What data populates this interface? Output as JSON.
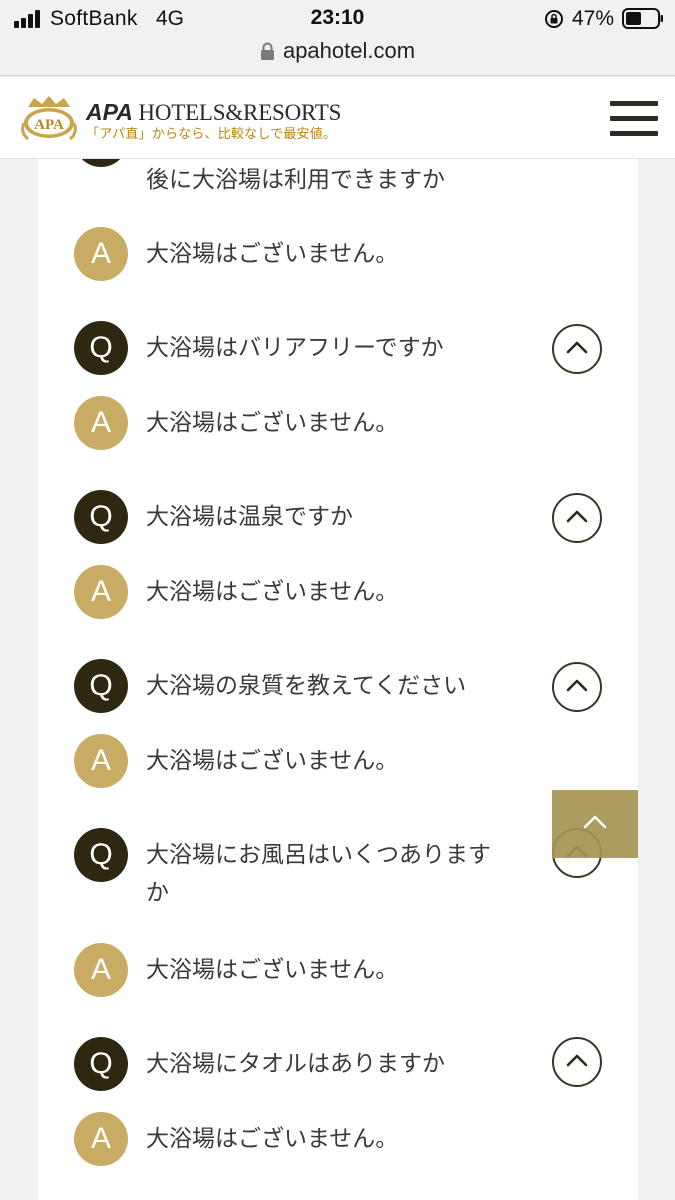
{
  "status_bar": {
    "carrier": "SoftBank",
    "network": "4G",
    "time": "23:10",
    "battery": "47%"
  },
  "browser": {
    "url": "apahotel.com"
  },
  "header": {
    "brand_prefix": "APA",
    "brand_suffix": " HOTELS&RESORTS",
    "tagline": "「アパ直」からなら、比較なしで最安値。",
    "emblem_text": "APA",
    "menu_icon": "hamburger-menu-icon"
  },
  "faq": {
    "partial_question": "後に大浴場は利用できますか",
    "items": [
      {
        "badge": "A",
        "text": "大浴場はございません。"
      },
      {
        "badge": "Q",
        "text": "大浴場はバリアフリーですか"
      },
      {
        "badge": "A",
        "text": "大浴場はございません。"
      },
      {
        "badge": "Q",
        "text": "大浴場は温泉ですか"
      },
      {
        "badge": "A",
        "text": "大浴場はございません。"
      },
      {
        "badge": "Q",
        "text": "大浴場の泉質を教えてください"
      },
      {
        "badge": "A",
        "text": "大浴場はございません。"
      },
      {
        "badge": "Q",
        "text": "大浴場にお風呂はいくつあります\nか"
      },
      {
        "badge": "A",
        "text": "大浴場はございません。"
      },
      {
        "badge": "Q",
        "text": "大浴場にタオルはありますか"
      },
      {
        "badge": "A",
        "text": "大浴場はございません。"
      }
    ]
  },
  "colors": {
    "question_badge": "#2e2813",
    "answer_badge": "#c8ac63",
    "back_to_top": "#a69452",
    "tagline": "#b8860b"
  }
}
